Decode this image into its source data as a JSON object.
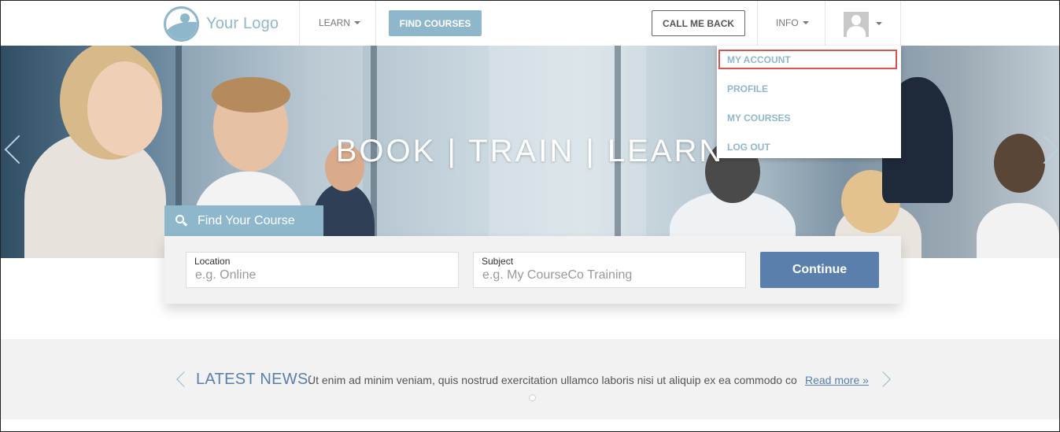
{
  "header": {
    "logo_text": "Your Logo",
    "learn_label": "LEARN",
    "find_courses_label": "FIND COURSES",
    "call_me_back_label": "CALL ME BACK",
    "info_label": "INFO"
  },
  "user_menu": {
    "items": [
      "MY ACCOUNT",
      "PROFILE",
      "MY COURSES",
      "LOG OUT"
    ],
    "highlighted": "MY ACCOUNT"
  },
  "hero": {
    "title": "BOOK | TRAIN | LEARN"
  },
  "search": {
    "tab_label": "Find Your Course",
    "location_label": "Location",
    "location_placeholder": "e.g. Online",
    "subject_label": "Subject",
    "subject_placeholder": "e.g. My CourseCo Training",
    "continue_label": "Continue"
  },
  "news": {
    "heading": "LATEST NEWS:",
    "text": "Ut enim ad minim veniam, quis nostrud exercitation ullamco laboris nisi ut aliquip ex ea commodo co",
    "read_more": "Read more »"
  },
  "colors": {
    "brand_light": "#8fb7cb",
    "brand_dark": "#5a7fac",
    "highlight_border": "#d9534f"
  },
  "icons": [
    "logo-icon",
    "chevron-down-icon",
    "avatar-icon",
    "search-icon",
    "chevron-left-icon",
    "chevron-right-icon"
  ]
}
